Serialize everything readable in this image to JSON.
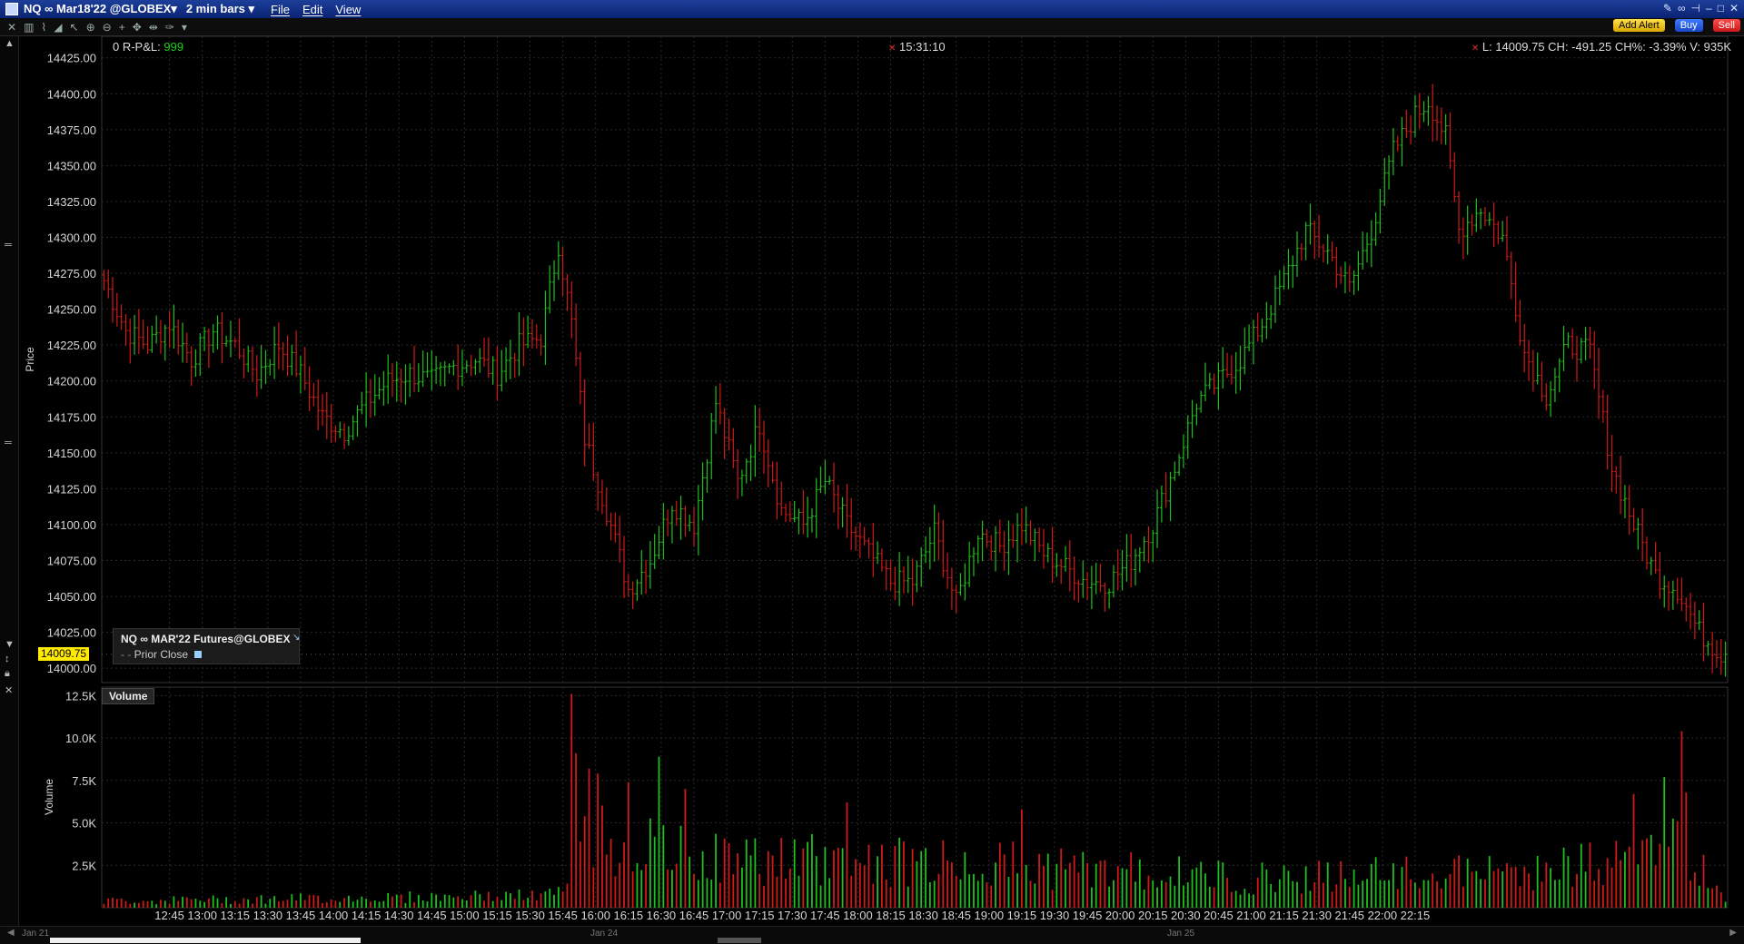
{
  "window": {
    "symbol": "NQ ∞ Mar18'22 @GLOBEX▾",
    "bar_size": "2 min bars ▾",
    "menus": [
      "File",
      "Edit",
      "View"
    ]
  },
  "toolbar": {
    "add_alert": "Add Alert",
    "buy": "Buy",
    "sell": "Sell"
  },
  "info": {
    "pnl_label": "0 R-P&L:",
    "pnl_value": "999",
    "time": "15:31:10",
    "stats": "L: 14009.75 CH: -491.25 CH%: -3.39% V: 935K"
  },
  "legend": {
    "title": "NQ ∞ MAR'22 Futures@GLOBEX",
    "prior_close": "Prior Close"
  },
  "last_price_tag": "14009.75",
  "volume_panel_label": "Volume",
  "colors": {
    "up": "#1fbf1f",
    "down": "#d01a1a",
    "grid": "#2a2a2a",
    "tag": "#ffea00"
  },
  "dates": [
    "Jan 21",
    "Jan 24",
    "Jan 25"
  ],
  "chart_data": [
    {
      "type": "ohlc",
      "title": "",
      "ylabel": "Price",
      "ylim": [
        13990,
        14440
      ],
      "yticks": [
        "14000.00",
        "14025.00",
        "14050.00",
        "14075.00",
        "14100.00",
        "14125.00",
        "14150.00",
        "14175.00",
        "14200.00",
        "14225.00",
        "14250.00",
        "14275.00",
        "14300.00",
        "14325.00",
        "14350.00",
        "14375.00",
        "14400.00",
        "14425.00"
      ],
      "xticks": [
        "12:45",
        "13:00",
        "13:15",
        "13:30",
        "13:45",
        "14:00",
        "14:15",
        "14:30",
        "14:45",
        "15:00",
        "15:15",
        "15:30",
        "15:45",
        "16:00",
        "16:15",
        "16:30",
        "16:45",
        "17:00",
        "17:15",
        "17:30",
        "17:45",
        "18:00",
        "18:15",
        "18:30",
        "18:45",
        "19:00",
        "19:15",
        "19:30",
        "19:45",
        "20:00",
        "20:15",
        "20:30",
        "20:45",
        "21:00",
        "21:15",
        "21:30",
        "21:45",
        "22:00",
        "22:15"
      ],
      "anchors": [
        [
          0,
          14270
        ],
        [
          5,
          14235
        ],
        [
          10,
          14225
        ],
        [
          15,
          14240
        ],
        [
          20,
          14215
        ],
        [
          25,
          14235
        ],
        [
          30,
          14225
        ],
        [
          35,
          14205
        ],
        [
          40,
          14225
        ],
        [
          45,
          14205
        ],
        [
          50,
          14175
        ],
        [
          55,
          14165
        ],
        [
          60,
          14185
        ],
        [
          65,
          14200
        ],
        [
          70,
          14205
        ],
        [
          75,
          14200
        ],
        [
          80,
          14210
        ],
        [
          85,
          14215
        ],
        [
          90,
          14205
        ],
        [
          95,
          14225
        ],
        [
          100,
          14230
        ],
        [
          104,
          14295
        ],
        [
          107,
          14240
        ],
        [
          110,
          14160
        ],
        [
          115,
          14110
        ],
        [
          120,
          14055
        ],
        [
          125,
          14075
        ],
        [
          130,
          14115
        ],
        [
          135,
          14100
        ],
        [
          140,
          14185
        ],
        [
          145,
          14130
        ],
        [
          150,
          14170
        ],
        [
          155,
          14110
        ],
        [
          160,
          14100
        ],
        [
          165,
          14130
        ],
        [
          170,
          14100
        ],
        [
          175,
          14080
        ],
        [
          180,
          14060
        ],
        [
          185,
          14060
        ],
        [
          190,
          14095
        ],
        [
          195,
          14045
        ],
        [
          200,
          14095
        ],
        [
          205,
          14085
        ],
        [
          210,
          14100
        ],
        [
          215,
          14080
        ],
        [
          220,
          14070
        ],
        [
          225,
          14060
        ],
        [
          230,
          14060
        ],
        [
          235,
          14075
        ],
        [
          240,
          14100
        ],
        [
          245,
          14140
        ],
        [
          250,
          14185
        ],
        [
          255,
          14200
        ],
        [
          260,
          14215
        ],
        [
          265,
          14240
        ],
        [
          270,
          14270
        ],
        [
          275,
          14305
        ],
        [
          280,
          14290
        ],
        [
          285,
          14265
        ],
        [
          290,
          14305
        ],
        [
          295,
          14360
        ],
        [
          300,
          14385
        ],
        [
          303,
          14395
        ],
        [
          307,
          14370
        ],
        [
          310,
          14305
        ],
        [
          315,
          14320
        ],
        [
          320,
          14300
        ],
        [
          325,
          14220
        ],
        [
          330,
          14190
        ],
        [
          335,
          14225
        ],
        [
          340,
          14220
        ],
        [
          345,
          14140
        ],
        [
          350,
          14100
        ],
        [
          355,
          14065
        ],
        [
          360,
          14055
        ],
        [
          365,
          14025
        ],
        [
          370,
          14010
        ]
      ],
      "last": 14009.75
    },
    {
      "type": "bar",
      "title": "",
      "ylabel": "Volume",
      "ylim": [
        0,
        13000
      ],
      "yticks": [
        "2.5K",
        "5.0K",
        "7.5K",
        "10.0K",
        "12.5K"
      ],
      "spikes": [
        [
          107,
          12600
        ],
        [
          108,
          9100
        ],
        [
          111,
          8200
        ],
        [
          113,
          7900
        ],
        [
          120,
          7400
        ],
        [
          127,
          8900
        ],
        [
          133,
          7000
        ],
        [
          170,
          6200
        ],
        [
          210,
          5800
        ],
        [
          350,
          6700
        ],
        [
          357,
          7700
        ],
        [
          361,
          10400
        ],
        [
          362,
          6800
        ]
      ],
      "profile": [
        [
          0,
          500
        ],
        [
          100,
          900
        ],
        [
          106,
          1200
        ],
        [
          108,
          5500
        ],
        [
          120,
          4500
        ],
        [
          140,
          3600
        ],
        [
          200,
          3300
        ],
        [
          260,
          2200
        ],
        [
          320,
          2600
        ],
        [
          345,
          3300
        ],
        [
          362,
          4500
        ],
        [
          370,
          800
        ]
      ]
    }
  ]
}
